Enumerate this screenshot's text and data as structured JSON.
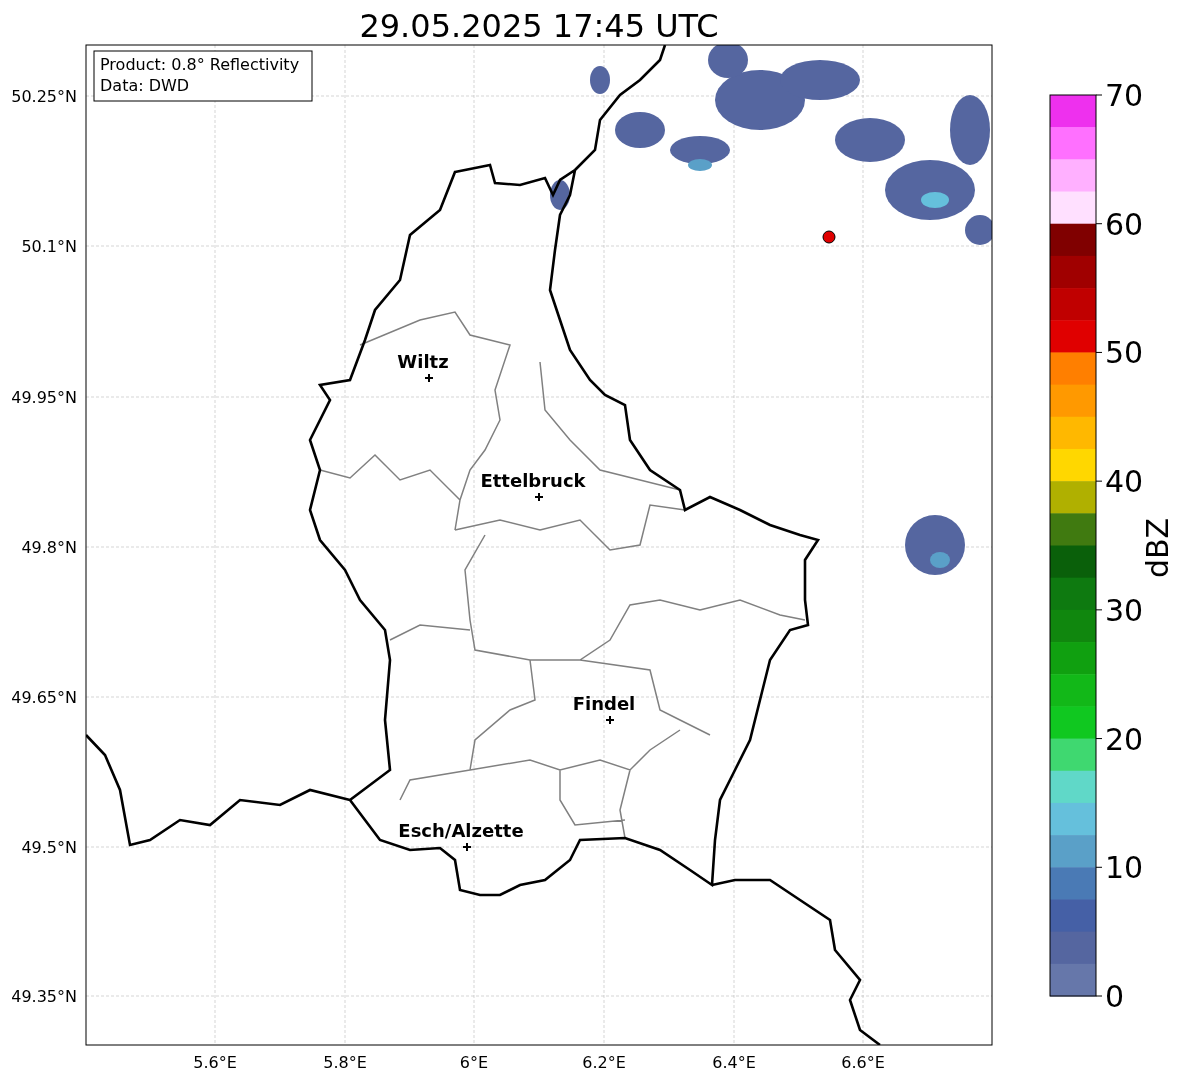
{
  "title": "29.05.2025 17:45 UTC",
  "info_box": [
    "Product: 0.8° Reflectivity",
    "Data: DWD"
  ],
  "map": {
    "lat_labels": [
      "50.25°N",
      "50.1°N",
      "49.95°N",
      "49.8°N",
      "49.65°N",
      "49.5°N",
      "49.35°N"
    ],
    "lon_labels": [
      "5.6°E",
      "5.8°E",
      "6°E",
      "6.2°E",
      "6.4°E",
      "6.6°E"
    ],
    "cities": [
      {
        "name": "Wiltz"
      },
      {
        "name": "Ettelbruck"
      },
      {
        "name": "Findel"
      },
      {
        "name": "Esch/Alzette"
      }
    ]
  },
  "colorbar": {
    "label": "dBZ",
    "ticks": [
      "70",
      "60",
      "50",
      "40",
      "30",
      "20",
      "10",
      "0"
    ],
    "bins": [
      {
        "color": "#ee30ee"
      },
      {
        "color": "#ff70ff"
      },
      {
        "color": "#ffb0ff"
      },
      {
        "color": "#ffe0ff"
      },
      {
        "color": "#800000"
      },
      {
        "color": "#a00000"
      },
      {
        "color": "#c00000"
      },
      {
        "color": "#e00000"
      },
      {
        "color": "#ff7f00"
      },
      {
        "color": "#ff9900"
      },
      {
        "color": "#ffb800"
      },
      {
        "color": "#ffd700"
      },
      {
        "color": "#b0b000"
      },
      {
        "color": "#407a10"
      },
      {
        "color": "#0a600a"
      },
      {
        "color": "#0e7a10"
      },
      {
        "color": "#10870e"
      },
      {
        "color": "#10a010"
      },
      {
        "color": "#12b818"
      },
      {
        "color": "#10c820"
      },
      {
        "color": "#3fd870"
      },
      {
        "color": "#60d8c8"
      },
      {
        "color": "#65c0dc"
      },
      {
        "color": "#5aa0c8"
      },
      {
        "color": "#4a7ab5"
      },
      {
        "color": "#4560a6"
      },
      {
        "color": "#5566a0"
      },
      {
        "color": "#6677aa"
      }
    ]
  }
}
